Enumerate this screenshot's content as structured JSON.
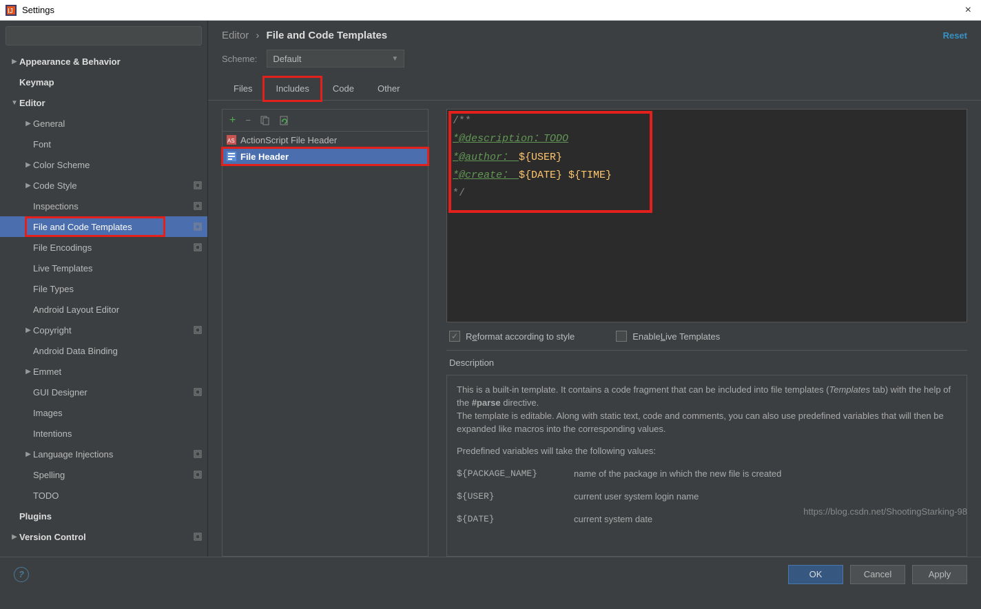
{
  "window": {
    "title": "Settings"
  },
  "sidebar": {
    "search_placeholder": "",
    "items": [
      {
        "label": "Appearance & Behavior",
        "lvl": 0,
        "arrow": "right",
        "bold": true
      },
      {
        "label": "Keymap",
        "lvl": 0,
        "arrow": "none",
        "bold": true
      },
      {
        "label": "Editor",
        "lvl": 0,
        "arrow": "down",
        "bold": true
      },
      {
        "label": "General",
        "lvl": 1,
        "arrow": "right"
      },
      {
        "label": "Font",
        "lvl": 1,
        "arrow": "none"
      },
      {
        "label": "Color Scheme",
        "lvl": 1,
        "arrow": "right"
      },
      {
        "label": "Code Style",
        "lvl": 1,
        "arrow": "right",
        "extra": true
      },
      {
        "label": "Inspections",
        "lvl": 1,
        "arrow": "none",
        "extra": true
      },
      {
        "label": "File and Code Templates",
        "lvl": 1,
        "arrow": "none",
        "extra": true,
        "selected": true,
        "highlight": true
      },
      {
        "label": "File Encodings",
        "lvl": 1,
        "arrow": "none",
        "extra": true
      },
      {
        "label": "Live Templates",
        "lvl": 1,
        "arrow": "none"
      },
      {
        "label": "File Types",
        "lvl": 1,
        "arrow": "none"
      },
      {
        "label": "Android Layout Editor",
        "lvl": 1,
        "arrow": "none"
      },
      {
        "label": "Copyright",
        "lvl": 1,
        "arrow": "right",
        "extra": true
      },
      {
        "label": "Android Data Binding",
        "lvl": 1,
        "arrow": "none"
      },
      {
        "label": "Emmet",
        "lvl": 1,
        "arrow": "right"
      },
      {
        "label": "GUI Designer",
        "lvl": 1,
        "arrow": "none",
        "extra": true
      },
      {
        "label": "Images",
        "lvl": 1,
        "arrow": "none"
      },
      {
        "label": "Intentions",
        "lvl": 1,
        "arrow": "none"
      },
      {
        "label": "Language Injections",
        "lvl": 1,
        "arrow": "right",
        "extra": true
      },
      {
        "label": "Spelling",
        "lvl": 1,
        "arrow": "none",
        "extra": true
      },
      {
        "label": "TODO",
        "lvl": 1,
        "arrow": "none"
      },
      {
        "label": "Plugins",
        "lvl": 0,
        "arrow": "none",
        "bold": true
      },
      {
        "label": "Version Control",
        "lvl": 0,
        "arrow": "right",
        "bold": true,
        "extra": true
      }
    ]
  },
  "breadcrumb": {
    "root": "Editor",
    "leaf": "File and Code Templates"
  },
  "reset": "Reset",
  "scheme": {
    "label": "Scheme:",
    "value": "Default"
  },
  "tabs": [
    "Files",
    "Includes",
    "Code",
    "Other"
  ],
  "active_tab": "Includes",
  "includes": {
    "items": [
      {
        "label": "ActionScript File Header",
        "type": "as"
      },
      {
        "label": "File Header",
        "type": "generic",
        "selected": true,
        "highlight": true
      }
    ]
  },
  "code": {
    "l1": "/**",
    "l2_tag": "*@description：",
    "l2_rest": "TODO",
    "l3_tag": "*@author： ",
    "l3_var": "${USER}",
    "l4_tag": "*@create： ",
    "l4_var1": "${DATE}",
    "l4_sp": " ",
    "l4_var2": "${TIME}",
    "l5": "*/"
  },
  "options": {
    "reformat_pre": "R",
    "reformat_ul": "e",
    "reformat_post": "format according to style",
    "live_pre": "Enable ",
    "live_ul": "L",
    "live_post": "ive Templates"
  },
  "description": {
    "heading": "Description",
    "p1_a": "This is a built-in template. It contains a code fragment that can be included into file templates (",
    "p1_em": "Templates",
    "p1_b": " tab) with the help of the ",
    "p1_bold": "#parse",
    "p1_c": " directive.",
    "p2": "The template is editable. Along with static text, code and comments, you can also use predefined variables that will then be expanded like macros into the corresponding values.",
    "p3": "Predefined variables will take the following values:",
    "vars": [
      {
        "k": "${PACKAGE_NAME}",
        "v": "name of the package in which the new file is created"
      },
      {
        "k": "${USER}",
        "v": "current user system login name"
      },
      {
        "k": "${DATE}",
        "v": "current system date"
      }
    ]
  },
  "footer": {
    "ok": "OK",
    "cancel": "Cancel",
    "apply": "Apply"
  },
  "watermark": "https://blog.csdn.net/ShootingStarking-98"
}
